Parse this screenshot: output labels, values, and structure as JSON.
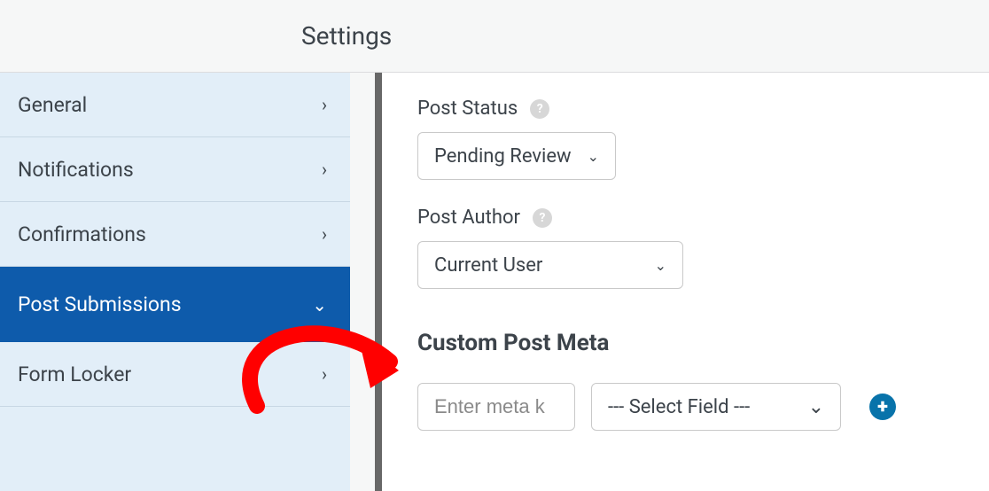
{
  "header": {
    "title": "Settings"
  },
  "sidebar": {
    "items": [
      {
        "label": "General"
      },
      {
        "label": "Notifications"
      },
      {
        "label": "Confirmations"
      },
      {
        "label": "Post Submissions"
      },
      {
        "label": "Form Locker"
      }
    ]
  },
  "panel": {
    "post_status": {
      "label": "Post Status",
      "value": "Pending Review"
    },
    "post_author": {
      "label": "Post Author",
      "value": "Current User"
    },
    "custom_meta": {
      "heading": "Custom Post Meta",
      "key_placeholder": "Enter meta k",
      "field_placeholder": "--- Select Field ---"
    }
  },
  "icons": {
    "chevron_right": "›",
    "chevron_down": "⌄",
    "help": "?",
    "plus": "+"
  }
}
